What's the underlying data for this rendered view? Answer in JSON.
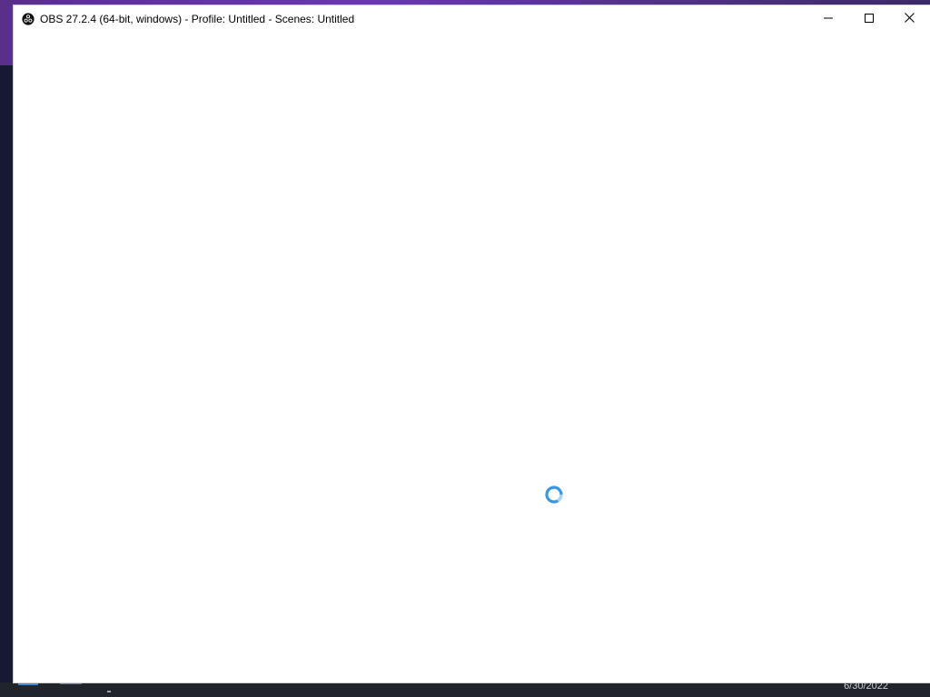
{
  "window": {
    "title": "OBS 27.2.4 (64-bit, windows) - Profile: Untitled - Scenes: Untitled",
    "app_icon": "obs-logo-icon",
    "controls": {
      "minimize_icon": "minimize-icon",
      "maximize_icon": "maximize-icon",
      "close_icon": "close-icon"
    }
  },
  "content": {
    "loading_indicator": "busy-spinner-icon"
  },
  "colors": {
    "titlebar_bg": "#ffffff",
    "spinner": "#3a96dd",
    "desktop_accent": "#6b3aa8",
    "taskbar": "#20242b"
  },
  "taskbar": {
    "clock_date": "6/30/2022"
  }
}
